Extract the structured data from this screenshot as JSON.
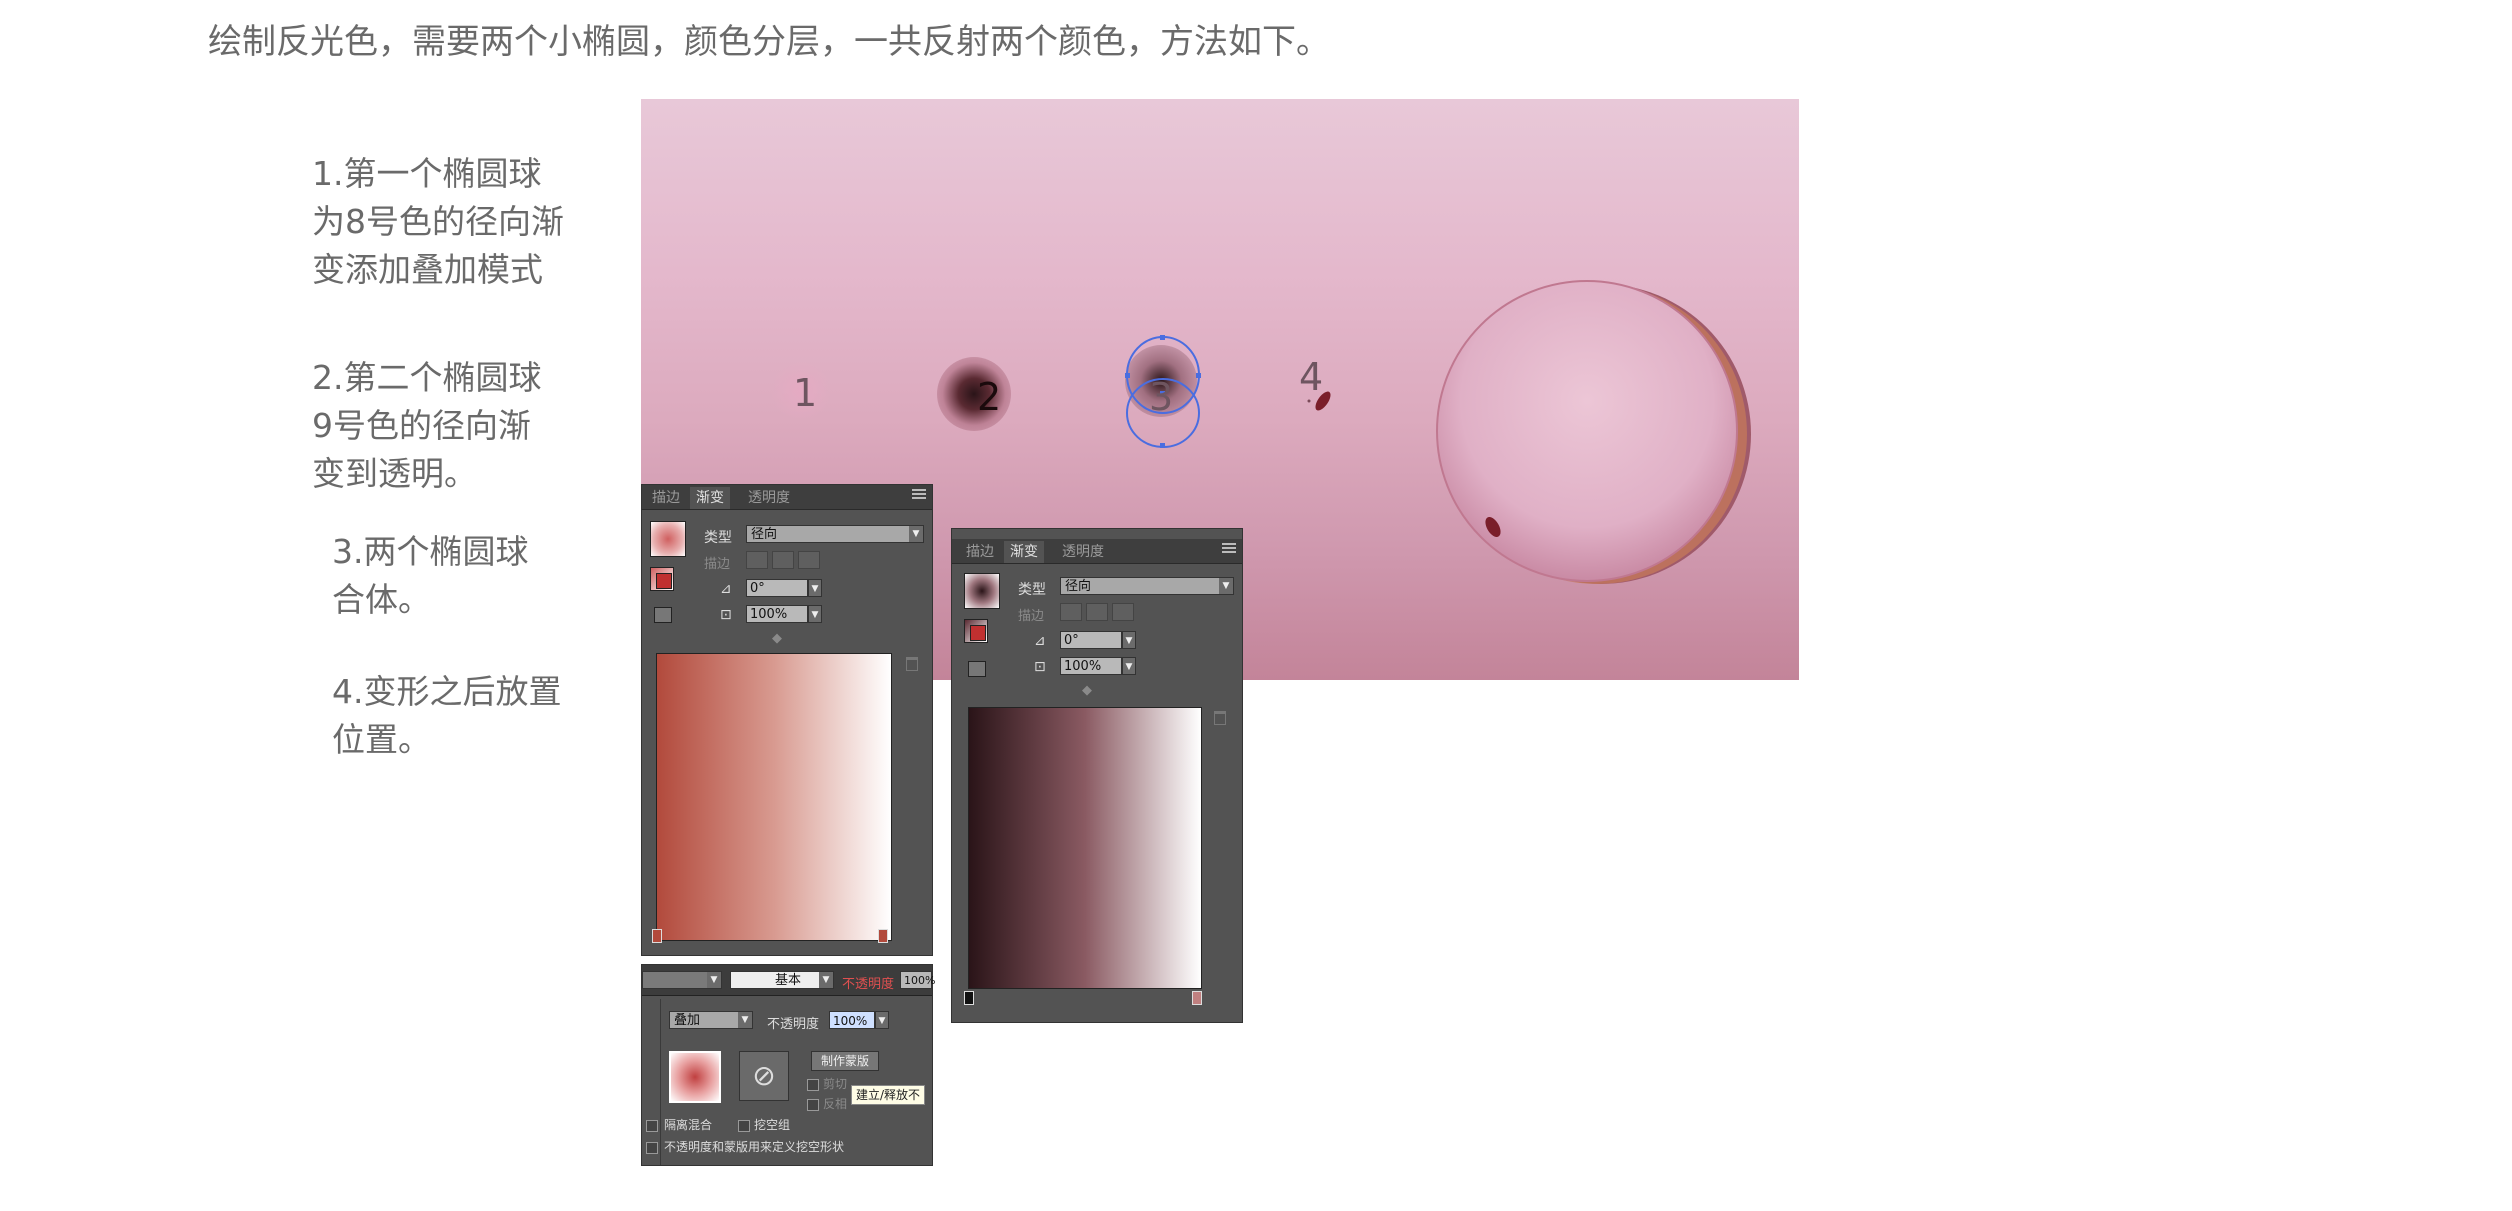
{
  "intro": "绘制反光色，需要两个小椭圆，颜色分层，一共反射两个颜色，方法如下。",
  "steps": {
    "s1": [
      "1.第一个椭圆球",
      "为8号色的径向渐",
      "变添加叠加模式"
    ],
    "s2": [
      "2.第二个椭圆球",
      "9号色的径向渐",
      "变到透明。"
    ],
    "s3": [
      "3.两个椭圆球",
      "合体。"
    ],
    "s4": [
      "4.变形之后放置",
      "位置。"
    ]
  },
  "canvas_labels": [
    "1",
    "2",
    "3",
    "4"
  ],
  "gradient_panel_1": {
    "tabs": [
      "描边",
      "渐变",
      "透明度"
    ],
    "type_label": "类型",
    "type_value": "径向",
    "stroke_label": "描边",
    "angle_value": "0°",
    "ratio_value": "100%",
    "start_color": "#b24a3c",
    "end_color": "#ffffff"
  },
  "gradient_panel_2": {
    "tabs": [
      "描边",
      "渐变",
      "透明度"
    ],
    "type_label": "类型",
    "type_value": "径向",
    "stroke_label": "描边",
    "angle_value": "0°",
    "ratio_value": "100%",
    "start_color": "#2a1418",
    "end_color": "#ffffff"
  },
  "transparency_panel": {
    "stroke_style": "基本",
    "opacity_top_label": "不透明度",
    "opacity_top_value": "100%",
    "blend_mode": "叠加",
    "opacity_label": "不透明度",
    "opacity_value": "100%",
    "make_mask_button": "制作蒙版",
    "clip_label": "剪切",
    "invert_label": "反相",
    "tooltip": "建立/释放不",
    "isolate_label": "隔离混合",
    "knockout_label": "挖空组",
    "mask_define_label": "不透明度和蒙版用来定义挖空形状"
  }
}
